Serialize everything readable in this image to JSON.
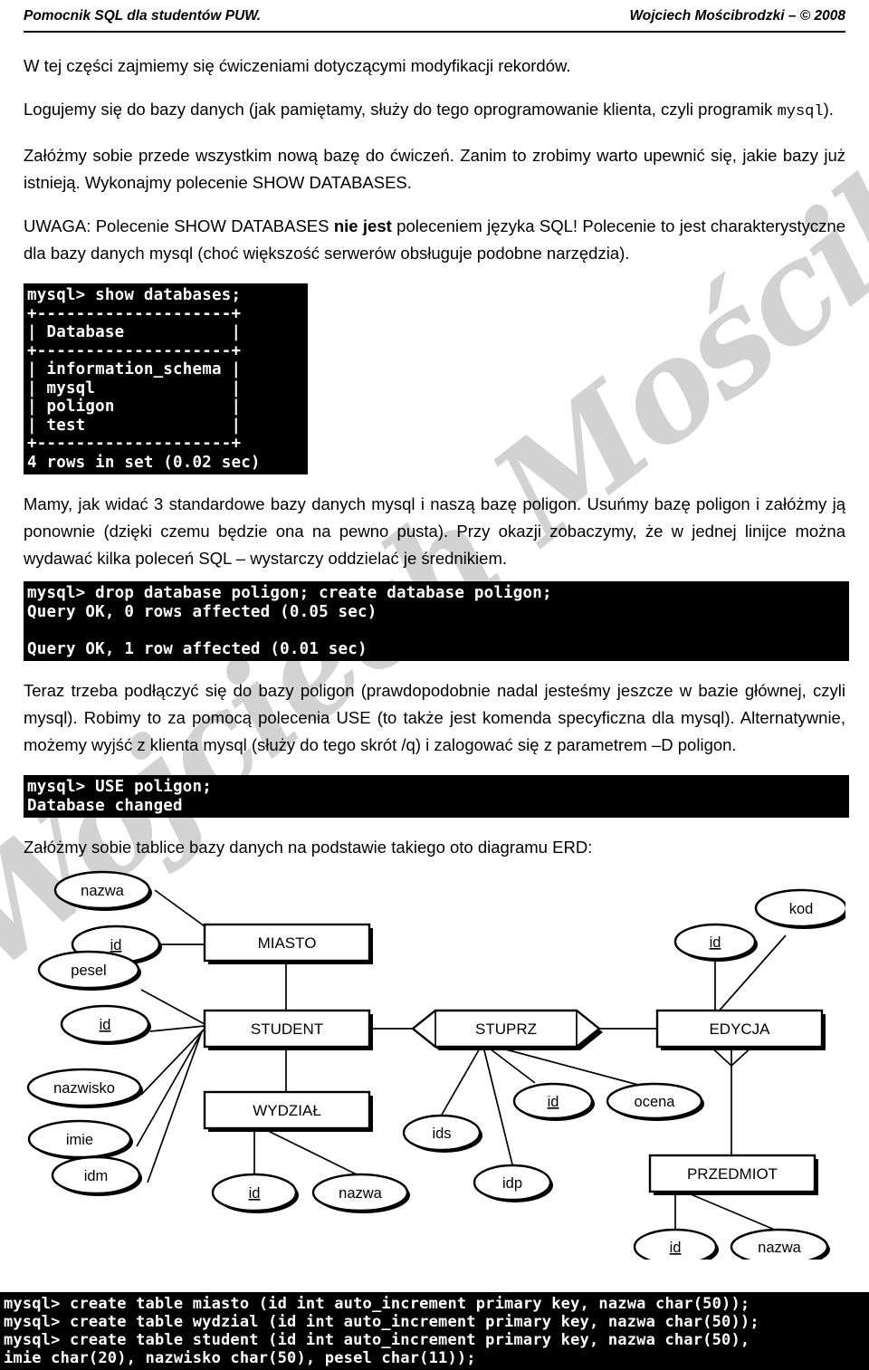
{
  "header": {
    "left": "Pomocnik SQL dla studentów PUW.",
    "right": "Wojciech Mościbrodzki – © 2008"
  },
  "watermark": {
    "text": "Wojciech Mościbrodzki",
    "color": "#d2d2d2"
  },
  "body": {
    "p1": "W tej części zajmiemy się ćwiczeniami dotyczącymi modyfikacji rekordów.",
    "p2_a": "Logujemy się do bazy danych (jak pamiętamy, służy do tego oprogramowanie klienta, czyli programik ",
    "p2_code": "mysql",
    "p2_b": ").",
    "p3": "Załóżmy sobie przede wszystkim nową bazę do ćwiczeń. Zanim to zrobimy warto upewnić się, jakie bazy już istnieją. Wykonajmy polecenie SHOW DATABASES.",
    "p4_a": "UWAGA: Polecenie SHOW DATABASES ",
    "p4_bold": "nie jest",
    "p4_b": " poleceniem języka SQL! Polecenie to jest charakterystyczne dla bazy danych mysql (choć większość serwerów obsługuje podobne narzędzia).",
    "p5": "Mamy, jak widać 3 standardowe bazy danych mysql i naszą bazę poligon. Usuńmy bazę poligon i załóżmy ją ponownie (dzięki czemu będzie ona na pewno pusta). Przy okazji zobaczymy, że w jednej linijce można wydawać kilka poleceń SQL – wystarczy oddzielać je średnikiem.",
    "p6": "Teraz trzeba podłączyć się do bazy poligon (prawdopodobnie nadal jesteśmy jeszcze w bazie głównej, czyli mysql). Robimy to za pomocą polecenia USE (to także jest komenda specyficzna dla mysql). Alternatywnie, możemy wyjść z klienta mysql (służy do tego skrót /q) i zalogować się z parametrem –D poligon.",
    "p7": "Załóżmy sobie tablice bazy danych na podstawie takiego oto diagramu ERD:"
  },
  "terminals": {
    "show_databases": "mysql> show databases;\n+--------------------+\n| Database           |\n+--------------------+\n| information_schema |\n| mysql              |\n| poligon            |\n| test               |\n+--------------------+\n4 rows in set (0.02 sec)",
    "drop_create": "mysql> drop database poligon; create database poligon;\nQuery OK, 0 rows affected (0.05 sec)\n\nQuery OK, 1 row affected (0.01 sec)",
    "use_poligon": "mysql> USE poligon;\nDatabase changed",
    "create_tables": "mysql> create table miasto (id int auto_increment primary key, nazwa char(50));\nmysql> create table wydzial (id int auto_increment primary key, nazwa char(50));\nmysql> create table student (id int auto_increment primary key, nazwa char(50),\nimie char(20), nazwisko char(50), pesel char(11));"
  },
  "erd": {
    "entities": [
      {
        "name": "MIASTO"
      },
      {
        "name": "STUDENT"
      },
      {
        "name": "WYDZIAŁ"
      },
      {
        "name": "EDYCJA"
      },
      {
        "name": "PRZEDMIOT"
      }
    ],
    "relationships": [
      {
        "name": "STUPRZ"
      }
    ],
    "attributes": {
      "miasto": [
        {
          "label": "nazwa",
          "key": false
        },
        {
          "label": "id",
          "key": true
        }
      ],
      "student": [
        {
          "label": "pesel",
          "key": false
        },
        {
          "label": "id",
          "key": true
        },
        {
          "label": "nazwisko",
          "key": false
        },
        {
          "label": "imie",
          "key": false
        },
        {
          "label": "idm",
          "key": false
        }
      ],
      "wydzial": [
        {
          "label": "id",
          "key": true
        },
        {
          "label": "nazwa",
          "key": false
        }
      ],
      "stuprz": [
        {
          "label": "ids",
          "key": false
        },
        {
          "label": "idp",
          "key": false
        },
        {
          "label": "id",
          "key": true
        },
        {
          "label": "ocena",
          "key": false
        }
      ],
      "edycja": [
        {
          "label": "id",
          "key": true
        },
        {
          "label": "kod",
          "key": false
        }
      ],
      "przedmiot": [
        {
          "label": "id",
          "key": true
        },
        {
          "label": "nazwa",
          "key": false
        }
      ]
    }
  }
}
